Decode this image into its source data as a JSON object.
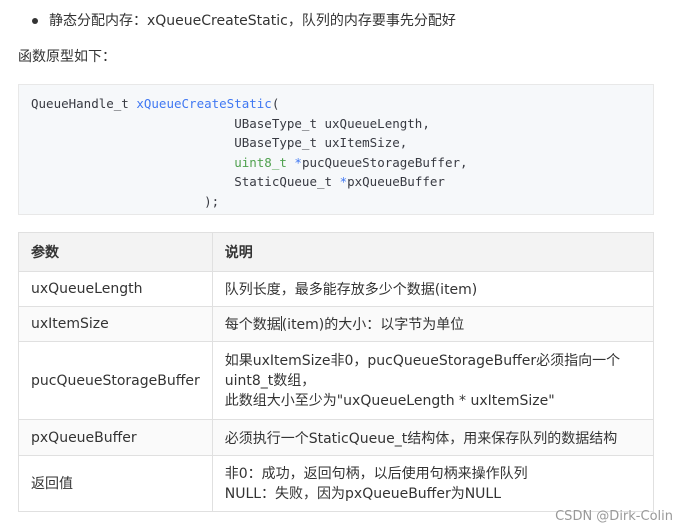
{
  "bullet": {
    "text": "静态分配内存：xQueueCreateStatic，队列的内存要事先分配好"
  },
  "intro": "函数原型如下：",
  "code": {
    "line1_type": "QueueHandle_t ",
    "line1_fn": "xQueueCreateStatic",
    "line1_paren": "(",
    "line2": "                           UBaseType_t uxQueueLength,",
    "line3": "                           UBaseType_t uxItemSize,",
    "line4_indent": "                           ",
    "line4_type": "uint8_t",
    "line4_star": " *",
    "line4_rest": "pucQueueStorageBuffer,",
    "line5_indent": "                           StaticQueue_t ",
    "line5_star": "*",
    "line5_rest": "pxQueueBuffer",
    "line6": "                       );"
  },
  "table": {
    "headers": [
      "参数",
      "说明"
    ],
    "rows": [
      {
        "param": "uxQueueLength",
        "desc": [
          "队列长度，最多能存放多少个数据(item)"
        ]
      },
      {
        "param": "uxItemSize",
        "desc_before": "每个数据",
        "desc_after": "(item)的大小：以字节为单位"
      },
      {
        "param": "pucQueueStorageBuffer",
        "desc": [
          "如果uxItemSize非0，pucQueueStorageBuffer必须指向一个",
          "uint8_t数组，",
          "此数组大小至少为\"uxQueueLength * uxItemSize\""
        ]
      },
      {
        "param": "pxQueueBuffer",
        "desc": [
          "必须执行一个StaticQueue_t结构体，用来保存队列的数据结构"
        ]
      },
      {
        "param": "返回值",
        "desc": [
          "非0：成功，返回句柄，以后使用句柄来操作队列",
          "NULL：失败，因为pxQueueBuffer为NULL"
        ]
      }
    ]
  },
  "watermark": "CSDN @Dirk-Colin"
}
